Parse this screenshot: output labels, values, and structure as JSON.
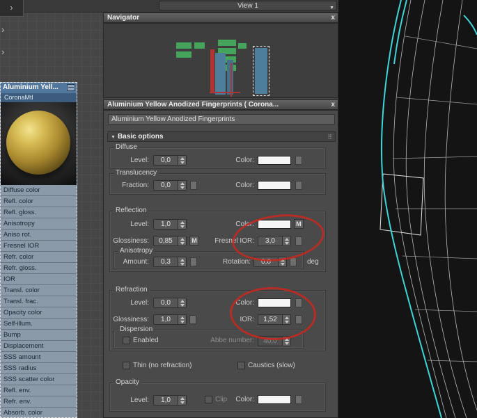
{
  "icons": {
    "chevron": "›",
    "dropdown": "▼",
    "close": "x",
    "minimize": "—",
    "grip": "⠿",
    "rollout_arrow": "▼"
  },
  "topbar": {
    "view_label": "View 1"
  },
  "navigator": {
    "title": "Navigator"
  },
  "material_window": {
    "title": "Aluminium Yellow Anodized Fingerprints  ( Corona...",
    "name_value": "Aluminium Yellow Anodized Fingerprints",
    "rollout_label": "Basic options"
  },
  "node": {
    "title": "Aluminium  Yell...",
    "subtitle": "CoronaMtl",
    "slots": [
      "Diffuse color",
      "Refl. color",
      "Refl. gloss.",
      "Anisotropy",
      "Aniso rot.",
      "Fresnel IOR",
      "Refr. color",
      "Refr. gloss.",
      "IOR",
      "Transl. color",
      "Transl. frac.",
      "Opacity color",
      "Self-illum.",
      "Bump",
      "Displacement",
      "SSS amount",
      "SSS radius",
      "SSS scatter color",
      "Refl. env.",
      "Refr. env.",
      "Absorb. color"
    ]
  },
  "params": {
    "diffuse": {
      "group": "Diffuse",
      "level_label": "Level:",
      "level": "0,0",
      "color_label": "Color:"
    },
    "translucency": {
      "group": "Translucency",
      "fraction_label": "Fraction:",
      "fraction": "0,0",
      "color_label": "Color:"
    },
    "reflection": {
      "group": "Reflection",
      "level_label": "Level:",
      "level": "1,0",
      "color_label": "Color:",
      "map_m": "M",
      "gloss_label": "Glossiness:",
      "gloss": "0,85",
      "gloss_m": "M",
      "fresnel_label": "Fresnel IOR:",
      "fresnel": "3,0",
      "aniso_group": "Anisotropy",
      "amount_label": "Amount:",
      "amount": "0,3",
      "rotation_label": "Rotation:",
      "rotation": "0,0",
      "deg_label": "deg"
    },
    "refraction": {
      "group": "Refraction",
      "level_label": "Level:",
      "level": "0,0",
      "color_label": "Color:",
      "gloss_label": "Glossiness:",
      "gloss": "1,0",
      "ior_label": "IOR:",
      "ior": "1,52",
      "dispersion_group": "Dispersion",
      "enabled_label": "Enabled",
      "abbe_label": "Abbe number:",
      "abbe": "40,0"
    },
    "flags": {
      "thin": "Thin (no refraction)",
      "caustics": "Caustics (slow)"
    },
    "opacity": {
      "group": "Opacity",
      "level_label": "Level:",
      "level": "1,0",
      "clip_label": "Clip",
      "color_label": "Color:"
    }
  },
  "colors": {
    "annotation_red": "#c8281e",
    "selection_cyan": "#3fd4da",
    "node_green": "#45a45c",
    "node_blue": "#4d7e9c",
    "node_red": "#b03434",
    "swatch_white": "#f5f5f5",
    "node_header_blue": "#52779c"
  }
}
